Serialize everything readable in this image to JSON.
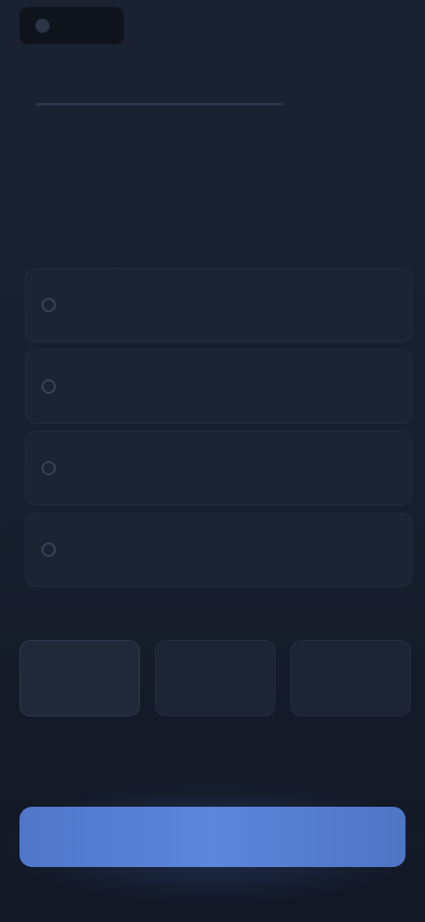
{
  "topbar": {
    "brand_name": "",
    "right_link": ""
  },
  "header": {
    "title": ""
  },
  "step": {
    "label": ""
  },
  "question": {
    "text": ""
  },
  "options": [
    {
      "label": ""
    },
    {
      "label": ""
    },
    {
      "label": ""
    },
    {
      "label": ""
    }
  ],
  "section": {
    "label": ""
  },
  "chips": [
    {
      "label": "",
      "selected": true
    },
    {
      "label": "",
      "selected": false
    },
    {
      "label": "",
      "selected": false
    }
  ],
  "cta": {
    "label": ""
  },
  "colors": {
    "background": "#161c29",
    "card": "#1c2333",
    "accent": "#5c86db"
  }
}
